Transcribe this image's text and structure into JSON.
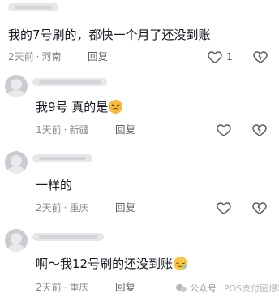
{
  "comments": [
    {
      "text": "我的7号刷的，都快一个月了还没到账",
      "time": "2天前",
      "location": "河南",
      "reply_label": "回复",
      "like_count": "1",
      "like_icon": "heart-outline-icon",
      "dislike_icon": "broken-heart-icon"
    },
    {
      "text": "我9号 真的是",
      "emoji": "sad-face-emoji",
      "time": "1天前",
      "location": "新疆",
      "reply_label": "回复",
      "like_icon": "heart-outline-icon",
      "dislike_icon": "broken-heart-icon"
    },
    {
      "text": "一样的",
      "time": "2天前",
      "location": "重庆",
      "reply_label": "回复",
      "like_icon": "heart-outline-icon",
      "dislike_icon": "broken-heart-icon"
    },
    {
      "text": "啊～我12号刷的还没到账",
      "emoji": "drooling-face-emoji",
      "time": "2天前",
      "location": "重庆",
      "reply_label": "回复",
      "like_icon": "heart-outline-icon",
      "dislike_icon": "broken-heart-icon"
    }
  ],
  "watermark": {
    "prefix": "公众号 ·",
    "name": "POS支付圈爆料"
  },
  "colors": {
    "text": "#161823",
    "meta": "#8a8b91",
    "icon": "#5c5d63"
  }
}
